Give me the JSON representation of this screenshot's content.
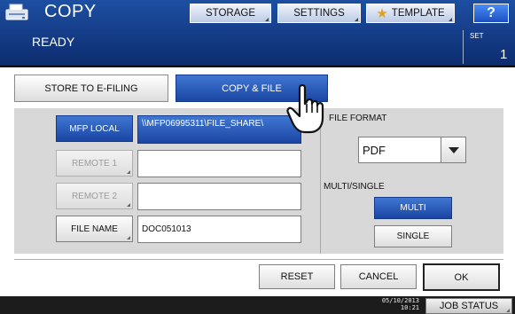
{
  "header": {
    "title": "COPY",
    "status": "READY",
    "set_label": "SET",
    "set_count": "1",
    "buttons": {
      "storage": "STORAGE",
      "settings": "SETTINGS",
      "template": "TEMPLATE",
      "help": "?"
    },
    "icons": {
      "app": "copier-icon",
      "template": "star-icon"
    }
  },
  "tabs": {
    "store_to_efiling": "STORE TO E-FILING",
    "copy_and_file": "COPY & FILE",
    "active": "copy_and_file"
  },
  "destinations": {
    "mfp_local": {
      "label": "MFP LOCAL",
      "value": "\\\\MFP06995311\\FILE_SHARE\\",
      "selected": true
    },
    "remote1": {
      "label": "REMOTE 1",
      "value": "",
      "enabled": false
    },
    "remote2": {
      "label": "REMOTE 2",
      "value": "",
      "enabled": false
    },
    "file_name": {
      "label": "FILE NAME",
      "value": "DOC051013"
    }
  },
  "file_format": {
    "label": "FILE FORMAT",
    "selected": "PDF"
  },
  "multi_single": {
    "label": "MULTI/SINGLE",
    "multi": "MULTI",
    "single": "SINGLE",
    "selected": "MULTI"
  },
  "actions": {
    "reset": "RESET",
    "cancel": "CANCEL",
    "ok": "OK"
  },
  "footer": {
    "date": "05/10/2013",
    "time": "10:21",
    "job_status": "JOB STATUS"
  },
  "colors": {
    "header_blue": "#1d4fa2",
    "active_blue": "#1b45a3",
    "panel_grey": "#d8d8d8"
  }
}
